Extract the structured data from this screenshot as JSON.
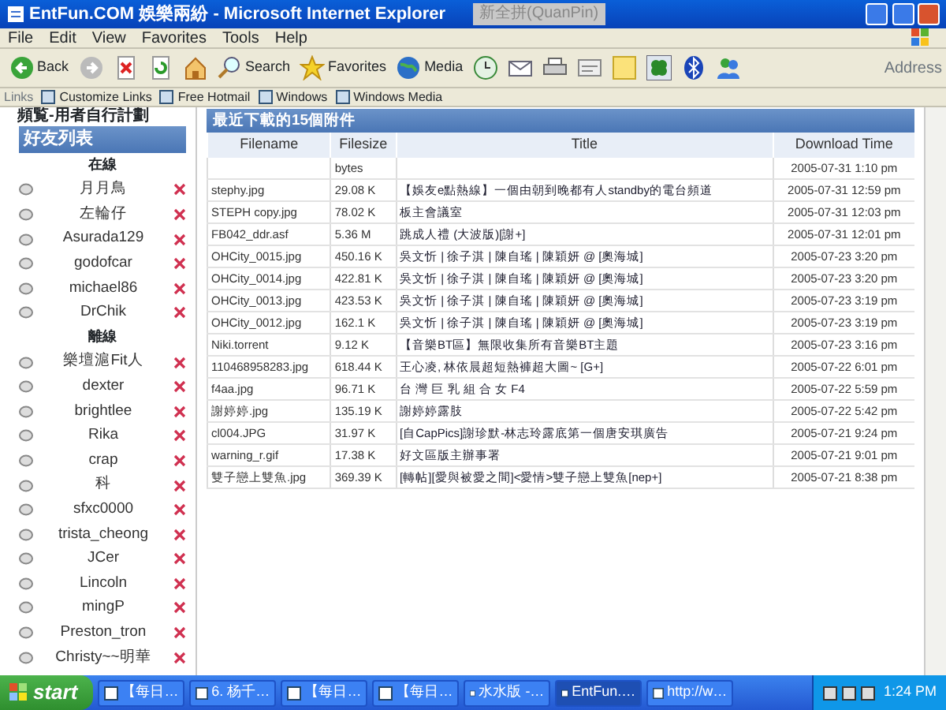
{
  "window": {
    "title": "EntFun.COM 娛樂兩紛 - Microsoft Internet Explorer",
    "ime_bar": "新全拼(QuanPin)"
  },
  "menu": [
    "File",
    "Edit",
    "View",
    "Favorites",
    "Tools",
    "Help"
  ],
  "toolbar": [
    {
      "kind": "back",
      "label": "Back"
    },
    {
      "kind": "forward"
    },
    {
      "kind": "stop"
    },
    {
      "kind": "refresh"
    },
    {
      "kind": "home"
    },
    {
      "kind": "search",
      "label": "Search"
    },
    {
      "kind": "favorites",
      "label": "Favorites"
    },
    {
      "kind": "media",
      "label": "Media"
    },
    {
      "kind": "history"
    },
    {
      "kind": "mail"
    },
    {
      "kind": "print"
    },
    {
      "kind": "edit"
    },
    {
      "kind": "note"
    },
    {
      "kind": "clover"
    },
    {
      "kind": "bluetooth"
    },
    {
      "kind": "messenger"
    }
  ],
  "address_label": "Address",
  "links": {
    "label": "Links",
    "items": [
      "Customize Links",
      "Free Hotmail",
      "Windows",
      "Windows Media"
    ]
  },
  "sidebar": {
    "top_title": "頻覧-用者自行計劃",
    "header": "好友列表",
    "sections": [
      {
        "label": "在線",
        "friends": [
          "月月鳥",
          "左輪仔",
          "Asurada129",
          "godofcar",
          "michael86",
          "DrChik"
        ]
      },
      {
        "label": "離線",
        "friends": [
          "樂壇滬Fit人",
          "dexter",
          "brightlee",
          "Rika",
          "crap",
          "科",
          "sfxc0000",
          "trista_cheong",
          "JCer",
          "Lincoln",
          "mingP",
          "Preston_tron",
          "Christy~~明華"
        ]
      }
    ]
  },
  "table": {
    "title": "最近下載的15個附件",
    "columns": [
      "Filename",
      "Filesize",
      "Title",
      "Download Time"
    ],
    "rows": [
      [
        "",
        "bytes",
        "",
        "2005-07-31 1:10 pm"
      ],
      [
        "stephy.jpg",
        "29.08 K",
        "【娛友e點熱線】一個由朝到晚都有人standby的電台頻道",
        "2005-07-31 12:59 pm"
      ],
      [
        "STEPH copy.jpg",
        "78.02 K",
        "板主會議室",
        "2005-07-31 12:03 pm"
      ],
      [
        "FB042_ddr.asf",
        "5.36 M",
        "跳成人禮 (大波版)[謝+]",
        "2005-07-31 12:01 pm"
      ],
      [
        "OHCity_0015.jpg",
        "450.16 K",
        "吳文忻 | 徐子淇 | 陳自瑤 | 陳穎妍 @ [奧海城]",
        "2005-07-23 3:20 pm"
      ],
      [
        "OHCity_0014.jpg",
        "422.81 K",
        "吳文忻 | 徐子淇 | 陳自瑤 | 陳穎妍 @ [奧海城]",
        "2005-07-23 3:20 pm"
      ],
      [
        "OHCity_0013.jpg",
        "423.53 K",
        "吳文忻 | 徐子淇 | 陳自瑤 | 陳穎妍 @ [奧海城]",
        "2005-07-23 3:19 pm"
      ],
      [
        "OHCity_0012.jpg",
        "162.1 K",
        "吳文忻 | 徐子淇 | 陳自瑤 | 陳穎妍 @ [奧海城]",
        "2005-07-23 3:19 pm"
      ],
      [
        "Niki.torrent",
        "9.12 K",
        "【音樂BT區】無限收集所有音樂BT主題",
        "2005-07-23 3:16 pm"
      ],
      [
        "110468958283.jpg",
        "618.44 K",
        "王心凌, 林依晨超短熱褲超大圖~ [G+]",
        "2005-07-22 6:01 pm"
      ],
      [
        "f4aa.jpg",
        "96.71 K",
        "台 灣 巨 乳 組 合 女 F4",
        "2005-07-22 5:59 pm"
      ],
      [
        "謝婷婷.jpg",
        "135.19 K",
        "謝婷婷露肢",
        "2005-07-22 5:42 pm"
      ],
      [
        "cl004.JPG",
        "31.97 K",
        "[自CapPics]謝珍默-林志玲露底第一個唐安琪廣告",
        "2005-07-21 9:24 pm"
      ],
      [
        "warning_r.gif",
        "17.38 K",
        "好文區版主辦事署",
        "2005-07-21 9:01 pm"
      ],
      [
        "雙子戀上雙魚.jpg",
        "369.39 K",
        "[轉帖][愛與被愛之間]<愛情>雙子戀上雙魚[nep+]",
        "2005-07-21 8:38 pm"
      ]
    ]
  },
  "taskbar": {
    "start": "start",
    "tasks": [
      {
        "label": "【每日…",
        "selected": false
      },
      {
        "label": "6. 杨千…",
        "selected": false
      },
      {
        "label": "【每日…",
        "selected": false
      },
      {
        "label": "【每日…",
        "selected": false
      },
      {
        "label": "水水版 -…",
        "selected": false
      },
      {
        "label": "EntFun.…",
        "selected": true
      },
      {
        "label": "http://w…",
        "selected": false
      }
    ],
    "clock": "1:24 PM"
  }
}
